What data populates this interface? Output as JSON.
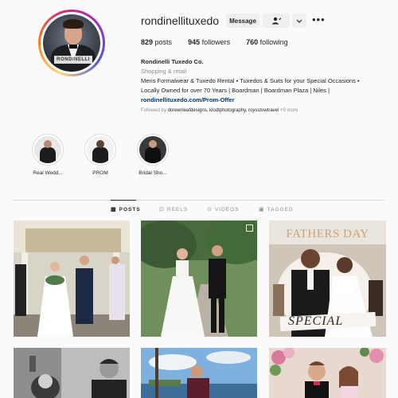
{
  "profile": {
    "username": "rondinellituxedo",
    "avatar_text": "RONDINELLI"
  },
  "actions": {
    "message_label": "Message",
    "follow_icon": "follow-person-icon",
    "chevron_icon": "chevron-down-icon",
    "more_icon": "more-icon"
  },
  "stats": {
    "posts_count": "829",
    "posts_label": "posts",
    "followers_count": "945",
    "followers_label": "followers",
    "following_count": "760",
    "following_label": "following"
  },
  "bio": {
    "name": "Rondinelli Tuxedo Co.",
    "category": "Shopping & retail",
    "line1": "Mens Formalwear & Tuxedo Rental • Tuxedos & Suits for your Special Occasions •",
    "line2": "Locally Owned for over 70 Years | Boardman | Boardman Plaza | Niles |",
    "link": "rondinellituxedo.com/Prom-Offer",
    "followed_prefix": "Followed by",
    "followed_names": "doreenleafdesigns, klodtphotography, roysstowtravel",
    "followed_more": "+9 more"
  },
  "highlights": [
    {
      "label": "Real Wedd..."
    },
    {
      "label": "PROM"
    },
    {
      "label": "Bridal Sho..."
    }
  ],
  "tabs": [
    {
      "label": "POSTS",
      "icon": "grid-icon",
      "active": true
    },
    {
      "label": "REELS",
      "icon": "reels-icon",
      "active": false
    },
    {
      "label": "VIDEOS",
      "icon": "video-icon",
      "active": false
    },
    {
      "label": "TAGGED",
      "icon": "tagged-icon",
      "active": false
    }
  ],
  "posts": {
    "p3_title": "FATHERS DAY",
    "p3_special": "SPECIAL"
  },
  "colors": {
    "link": "#00376b",
    "secondary_text": "#8e8e8e",
    "button_bg": "#efefef"
  }
}
